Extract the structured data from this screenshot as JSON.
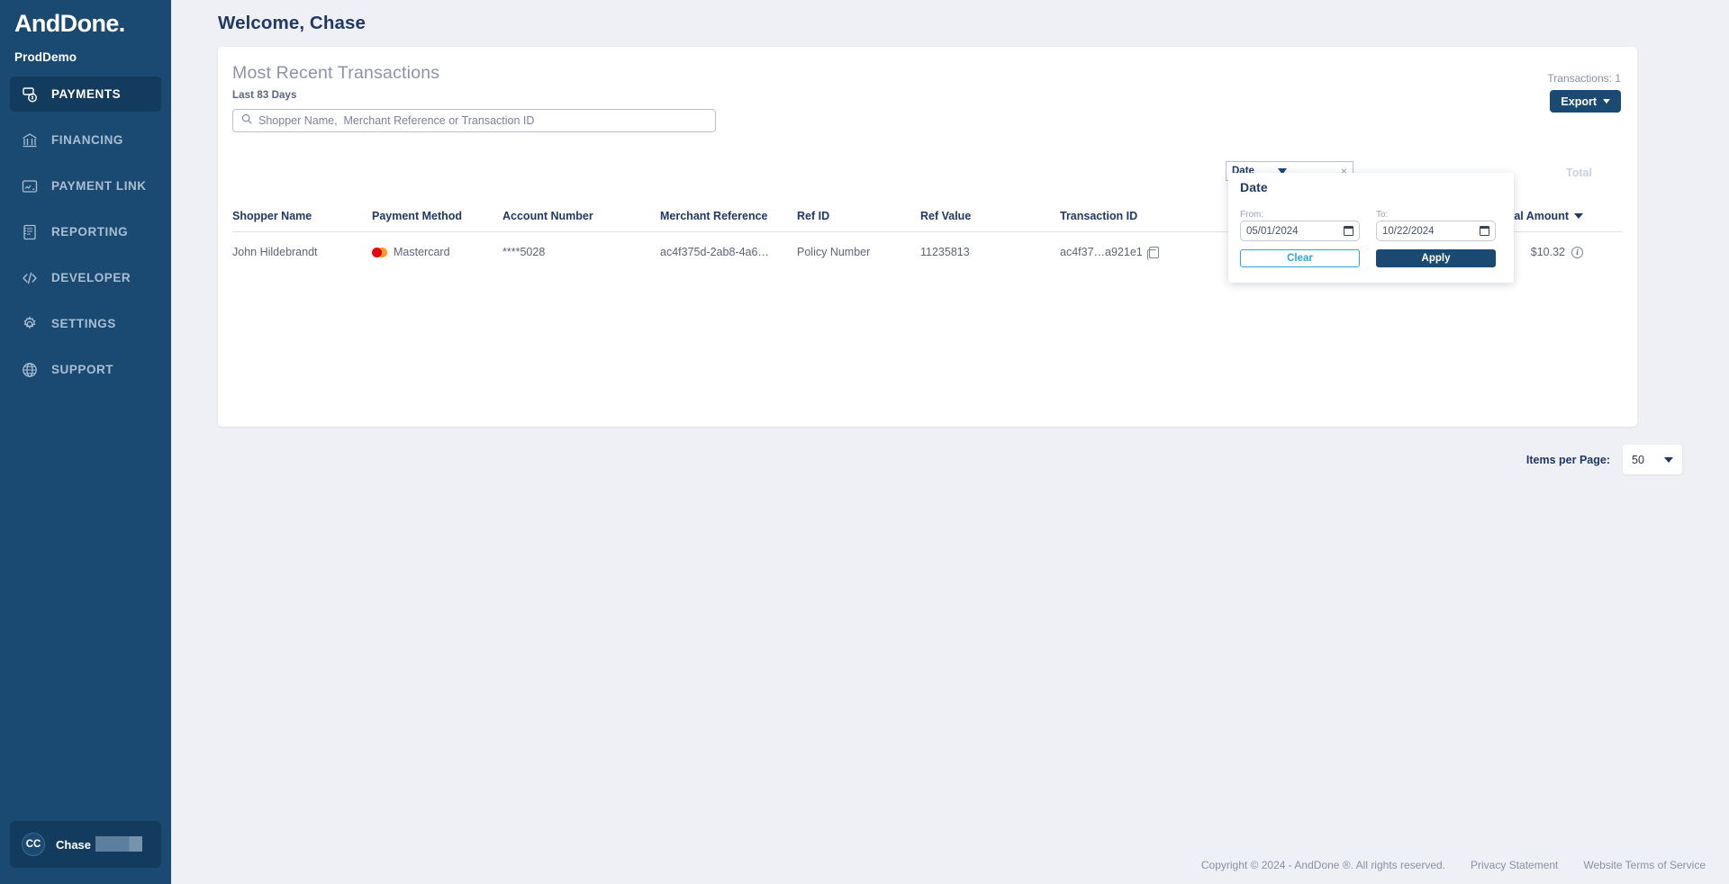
{
  "sidebar": {
    "logo": "AndDone",
    "logo_dot": ".",
    "tenant": "ProdDemo",
    "items": [
      {
        "label": "PAYMENTS",
        "icon": "payments-icon",
        "active": true
      },
      {
        "label": "FINANCING",
        "icon": "bank-icon",
        "active": false
      },
      {
        "label": "PAYMENT LINK",
        "icon": "payment-link-icon",
        "active": false
      },
      {
        "label": "REPORTING",
        "icon": "report-icon",
        "active": false
      },
      {
        "label": "DEVELOPER",
        "icon": "code-icon",
        "active": false
      },
      {
        "label": "SETTINGS",
        "icon": "gear-icon",
        "active": false
      },
      {
        "label": "SUPPORT",
        "icon": "globe-icon",
        "active": false
      }
    ],
    "user": {
      "initials": "CC",
      "name": "Chase"
    }
  },
  "header": {
    "greeting": "Welcome, Chase"
  },
  "card": {
    "title": "Most Recent Transactions",
    "subtitle": "Last 83 Days",
    "transactions_count": "Transactions: 1",
    "export_label": "Export"
  },
  "search": {
    "placeholder": "Shopper Name,  Merchant Reference or Transaction ID",
    "value": ""
  },
  "table": {
    "columns": [
      "Shopper Name",
      "Payment Method",
      "Account Number",
      "Merchant Reference",
      "Ref ID",
      "Ref Value",
      "Transaction ID",
      "Total Amount"
    ],
    "ghost_column": "Total",
    "rows": [
      {
        "shopper_name": "John Hildebrandt",
        "payment_method": "Mastercard",
        "payment_brand_icon": "mastercard-icon",
        "account_number": "****5028",
        "merchant_reference": "ac4f375d-2ab8-4a6…",
        "ref_id": "Policy Number",
        "ref_value": "11235813",
        "transaction_id": "ac4f37…a921e1",
        "total_amount": "$10.32"
      }
    ]
  },
  "filter_chip": {
    "label": "Date",
    "close": "×"
  },
  "date_popup": {
    "title": "Date",
    "from_label": "From:",
    "from_value": "05/01/2024",
    "to_label": "To:",
    "to_value": "10/22/2024",
    "clear_label": "Clear",
    "apply_label": "Apply"
  },
  "pagination": {
    "label": "Items per Page:",
    "value": "50"
  },
  "footer": {
    "copyright": "Copyright © 2024 - AndDone ®. All rights reserved.",
    "privacy": "Privacy Statement",
    "terms": "Website Terms of Service"
  },
  "colors": {
    "sidebar_bg": "#1a4a72",
    "sidebar_active": "#123b5e",
    "accent_navy": "#1f3864",
    "page_bg": "#eef0f5",
    "link_blue": "#2aa8e0"
  }
}
